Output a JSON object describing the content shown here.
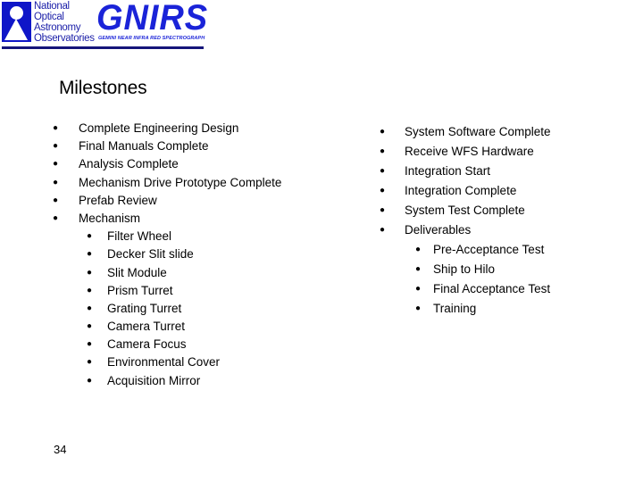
{
  "header": {
    "org_lines": [
      "National",
      "Optical",
      "Astronomy",
      "Observatories"
    ],
    "logo_title": "GNIRS",
    "logo_subtitle": "GEMINI NEAR INFRA RED SPECTROGRAPH",
    "colors": {
      "brand_blue": "#1a23d8",
      "rule": "#15157a"
    }
  },
  "slide": {
    "title": "Milestones",
    "page_number": "34",
    "left_list": [
      {
        "label": "Complete Engineering Design"
      },
      {
        "label": "Final Manuals Complete"
      },
      {
        "label": "Analysis Complete"
      },
      {
        "label": "Mechanism Drive Prototype Complete"
      },
      {
        "label": "Prefab Review"
      },
      {
        "label": "Mechanism",
        "children": [
          "Filter Wheel",
          "Decker Slit slide",
          "Slit Module",
          "Prism Turret",
          "Grating Turret",
          "Camera Turret",
          "Camera Focus",
          "Environmental Cover",
          "Acquisition Mirror"
        ]
      }
    ],
    "right_list": [
      {
        "label": "System Software Complete"
      },
      {
        "label": "Receive WFS Hardware"
      },
      {
        "label": "Integration Start"
      },
      {
        "label": "Integration Complete"
      },
      {
        "label": "System Test Complete"
      },
      {
        "label": "Deliverables",
        "children": [
          "Pre-Acceptance Test",
          "Ship to Hilo",
          "Final Acceptance Test",
          "Training"
        ]
      }
    ],
    "bullet_glyph": "●"
  }
}
